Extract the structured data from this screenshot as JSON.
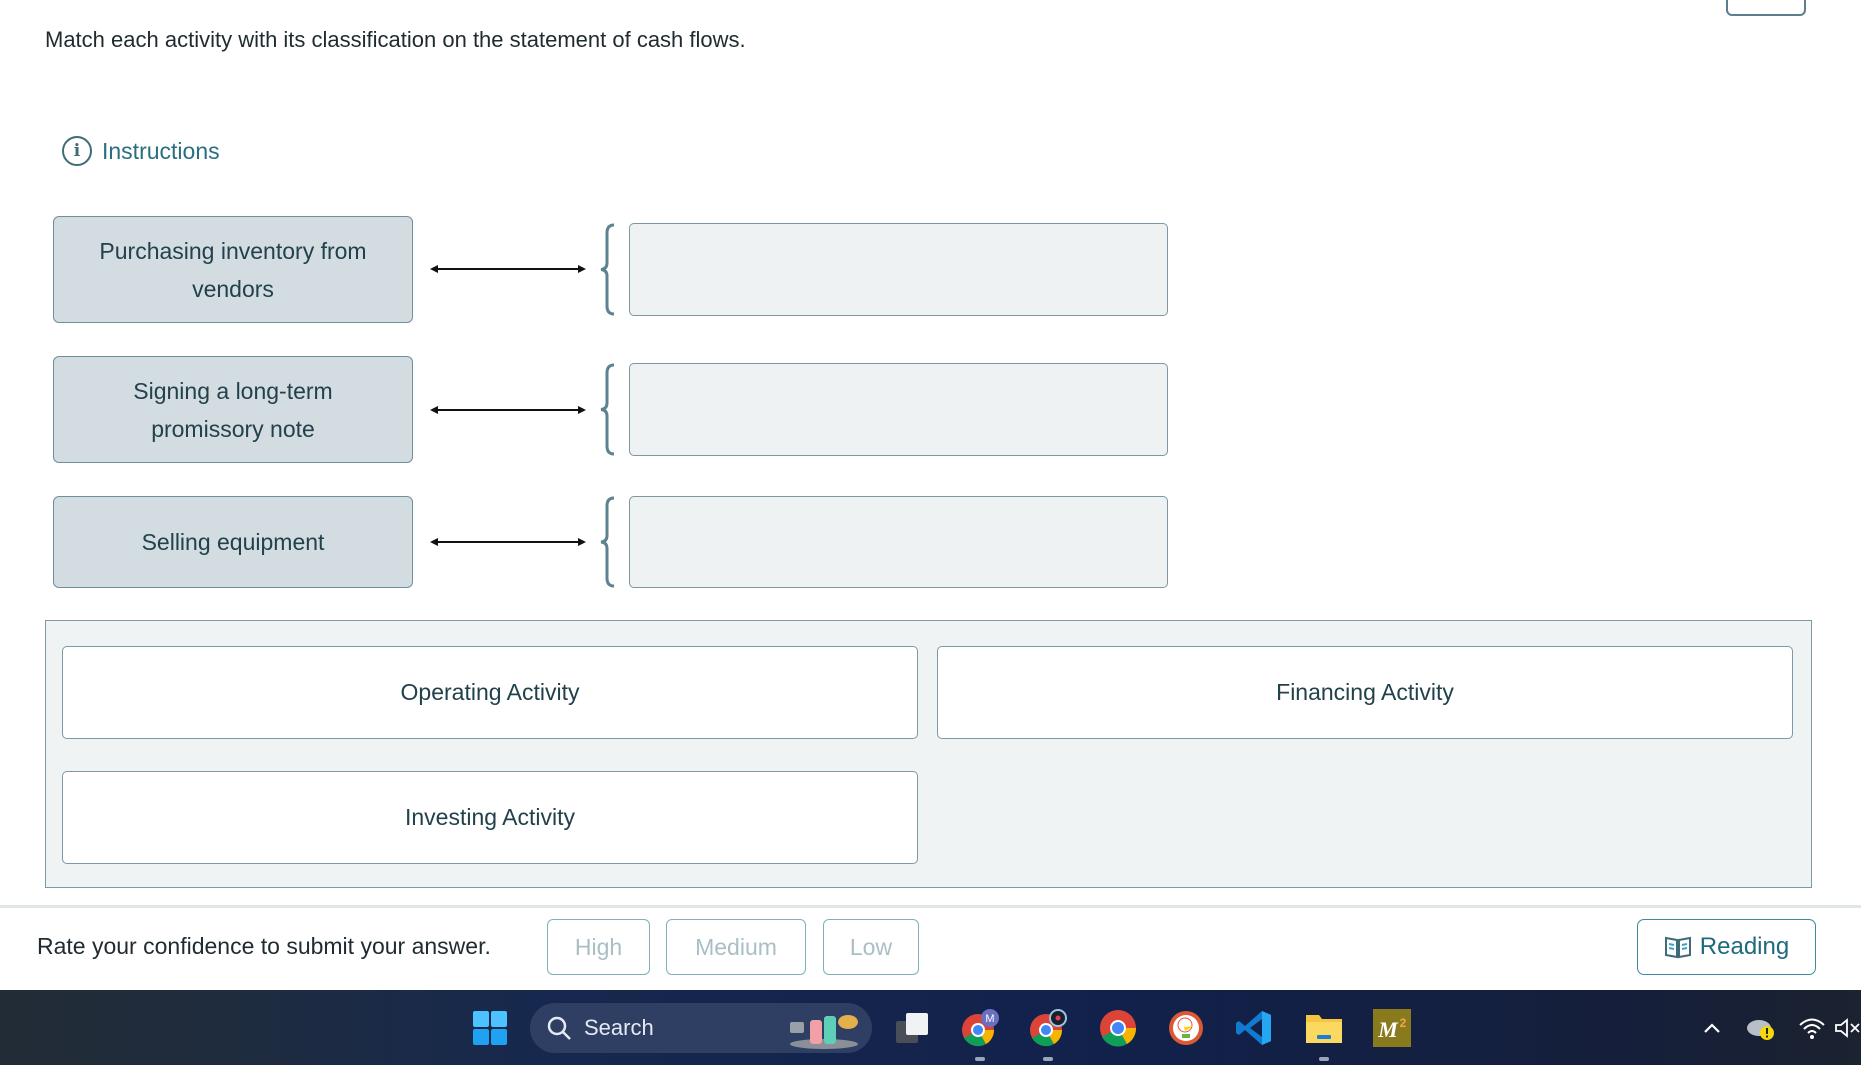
{
  "prompt": "Match each activity with its classification on the statement of cash flows.",
  "instructions": {
    "icon": "info-icon",
    "label": "Instructions"
  },
  "activities": [
    {
      "label": "Purchasing inventory from vendors",
      "matched": ""
    },
    {
      "label": "Signing a long-term promissory note",
      "matched": ""
    },
    {
      "label": "Selling equipment",
      "matched": ""
    }
  ],
  "choices": [
    {
      "label": "Operating Activity"
    },
    {
      "label": "Financing Activity"
    },
    {
      "label": "Investing Activity"
    }
  ],
  "confidence": {
    "prompt": "Rate your confidence to submit your answer.",
    "buttons": [
      {
        "label": "High"
      },
      {
        "label": "Medium"
      },
      {
        "label": "Low"
      }
    ]
  },
  "reading_button": {
    "icon": "book-icon",
    "label": "Reading"
  },
  "colors": {
    "accent": "#2a6f80",
    "card_bg": "#d3dde1",
    "drop_bg": "#eef2f3",
    "border": "#7a97a2",
    "disabled_text": "#a9bfc5"
  },
  "taskbar": {
    "search_placeholder": "Search",
    "apps": [
      {
        "name": "task-view",
        "icon": "task-view-icon"
      },
      {
        "name": "chrome-profile-m",
        "icon": "chrome-icon",
        "badge": "M",
        "running": true
      },
      {
        "name": "chrome-profile-2",
        "icon": "chrome-icon",
        "running": true
      },
      {
        "name": "chrome",
        "icon": "chrome-icon"
      },
      {
        "name": "duckduckgo",
        "icon": "duckduckgo-icon"
      },
      {
        "name": "vscode",
        "icon": "vscode-icon"
      },
      {
        "name": "file-explorer",
        "icon": "folder-icon",
        "running": true
      },
      {
        "name": "m2",
        "icon": "m2-app-icon",
        "label": "M2"
      }
    ],
    "tray": [
      "chevron-up-icon",
      "onedrive-warning-icon",
      "wifi-icon",
      "volume-muted-icon"
    ]
  }
}
